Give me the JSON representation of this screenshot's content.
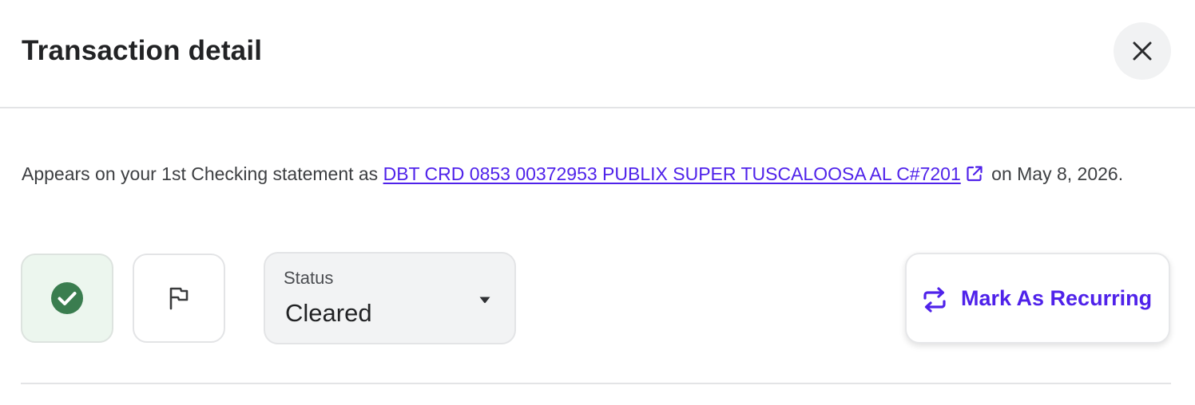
{
  "header": {
    "title": "Transaction detail",
    "close_icon": "close-icon"
  },
  "statement": {
    "prefix": "Appears on your 1st Checking statement as ",
    "merchant_link": "DBT CRD 0853 00372953 PUBLIX SUPER TUSCALOOSA AL C#7201",
    "link_icon": "external-link-icon",
    "suffix": " on May 8, 2026."
  },
  "actions": {
    "review_icon": "check-circle-icon",
    "reviewed": true,
    "flag_icon": "flag-icon",
    "status": {
      "label": "Status",
      "value": "Cleared",
      "icon": "caret-down-icon"
    },
    "recurring": {
      "label": "Mark As Recurring",
      "icon": "repeat-icon"
    }
  },
  "colors": {
    "accent": "#4f22ea",
    "reviewed_green": "#3a7d4f",
    "reviewed_bg": "#ecf6ee"
  }
}
